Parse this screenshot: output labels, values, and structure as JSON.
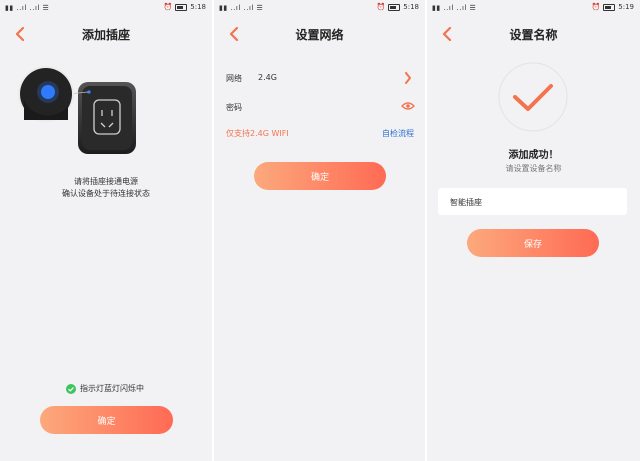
{
  "colors": {
    "accent": "#f4734f",
    "link": "#2b6fd1",
    "success_green": "#3cc55c",
    "button_gradient_start": "#fca97c",
    "button_gradient_end": "#ff6a55"
  },
  "screen1": {
    "status": {
      "time": "5:18"
    },
    "title": "添加插座",
    "instruction_line1": "请将插座接通电源",
    "instruction_line2": "确认设备处于待连接状态",
    "indicator_text": "指示灯蓝灯闪烁中",
    "confirm_label": "确定"
  },
  "screen2": {
    "status": {
      "time": "5:18"
    },
    "title": "设置网络",
    "network_label": "网络",
    "network_value": "2.4G",
    "password_label": "密码",
    "wifi_note": "仅支持2.4G WIFI",
    "self_check_link": "自检流程",
    "confirm_label": "确定"
  },
  "screen3": {
    "status": {
      "time": "5:19"
    },
    "title": "设置名称",
    "success_text": "添加成功！",
    "prompt_text": "请设置设备名称",
    "name_value": "智能插座",
    "save_label": "保存"
  },
  "icons": {
    "back": "chevron-left-icon",
    "eye": "eye-icon",
    "arrow": "chevron-right-icon",
    "check": "checkmark-icon",
    "indicator": "check-circle-icon"
  }
}
